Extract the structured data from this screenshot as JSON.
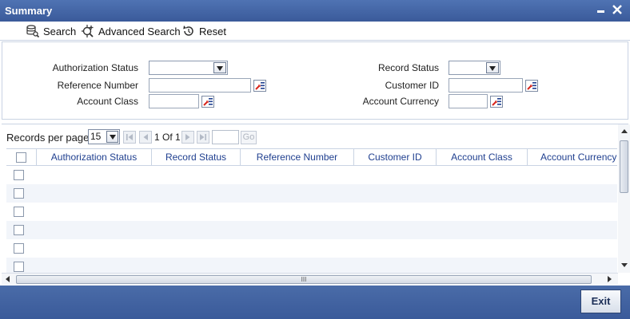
{
  "window": {
    "title": "Summary",
    "minimize_glyph": "▁",
    "close_glyph": "✕"
  },
  "toolbar": {
    "search_label": "Search",
    "advanced_search_label": "Advanced Search",
    "reset_label": "Reset"
  },
  "criteria": {
    "authorization_status_label": "Authorization Status",
    "reference_number_label": "Reference Number",
    "account_class_label": "Account Class",
    "record_status_label": "Record Status",
    "customer_id_label": "Customer ID",
    "account_currency_label": "Account Currency",
    "authorization_status_value": "",
    "record_status_value": "",
    "reference_number_value": "",
    "customer_id_value": "",
    "account_class_value": "",
    "account_currency_value": ""
  },
  "pager": {
    "records_per_page_label": "Records per page",
    "records_per_page_value": "15",
    "page_indicator": "1 Of 1",
    "go_label": "Go",
    "page_input_value": ""
  },
  "table": {
    "columns": [
      "Authorization Status",
      "Record Status",
      "Reference Number",
      "Customer ID",
      "Account Class",
      "Account Currency"
    ],
    "rows_visible": 6
  },
  "scroll": {
    "h_thumb_grip": "III"
  },
  "footer": {
    "exit_label": "Exit"
  },
  "colors": {
    "titlebar": "#3a5a9a",
    "header_text": "#1f3f8f",
    "alt_row": "#f2f5fa"
  }
}
